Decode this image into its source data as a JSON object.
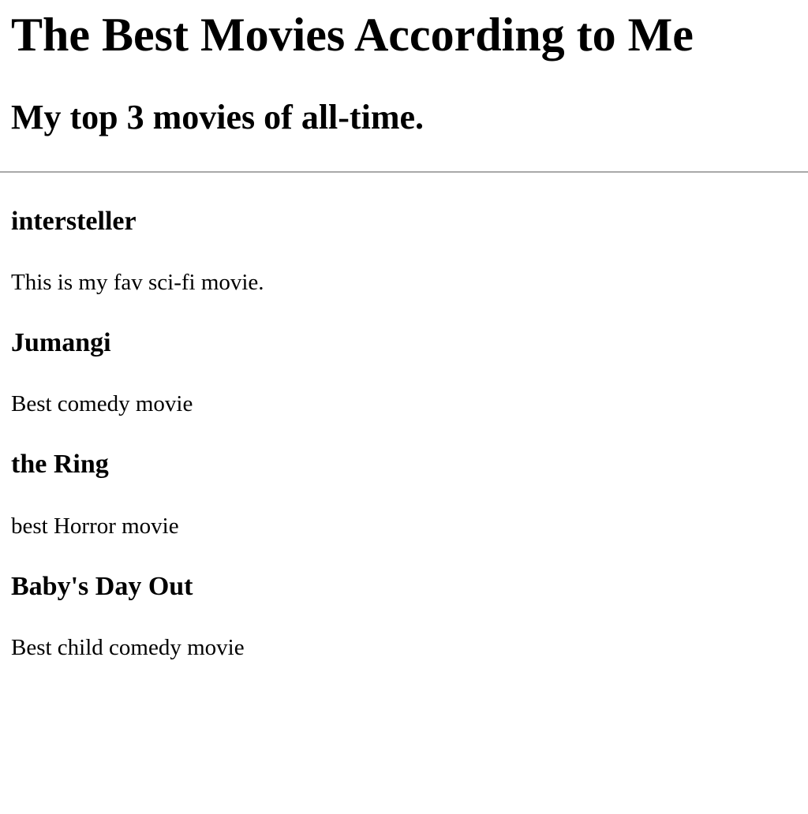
{
  "page": {
    "title": "The Best Movies According to Me",
    "subtitle": "My top 3 movies of all-time."
  },
  "movies": [
    {
      "title": "intersteller",
      "description": "This is my fav sci-fi movie."
    },
    {
      "title": "Jumangi",
      "description": "Best comedy movie"
    },
    {
      "title": "the Ring",
      "description": "best Horror movie"
    },
    {
      "title": "Baby's Day Out",
      "description": "Best child comedy movie"
    }
  ]
}
